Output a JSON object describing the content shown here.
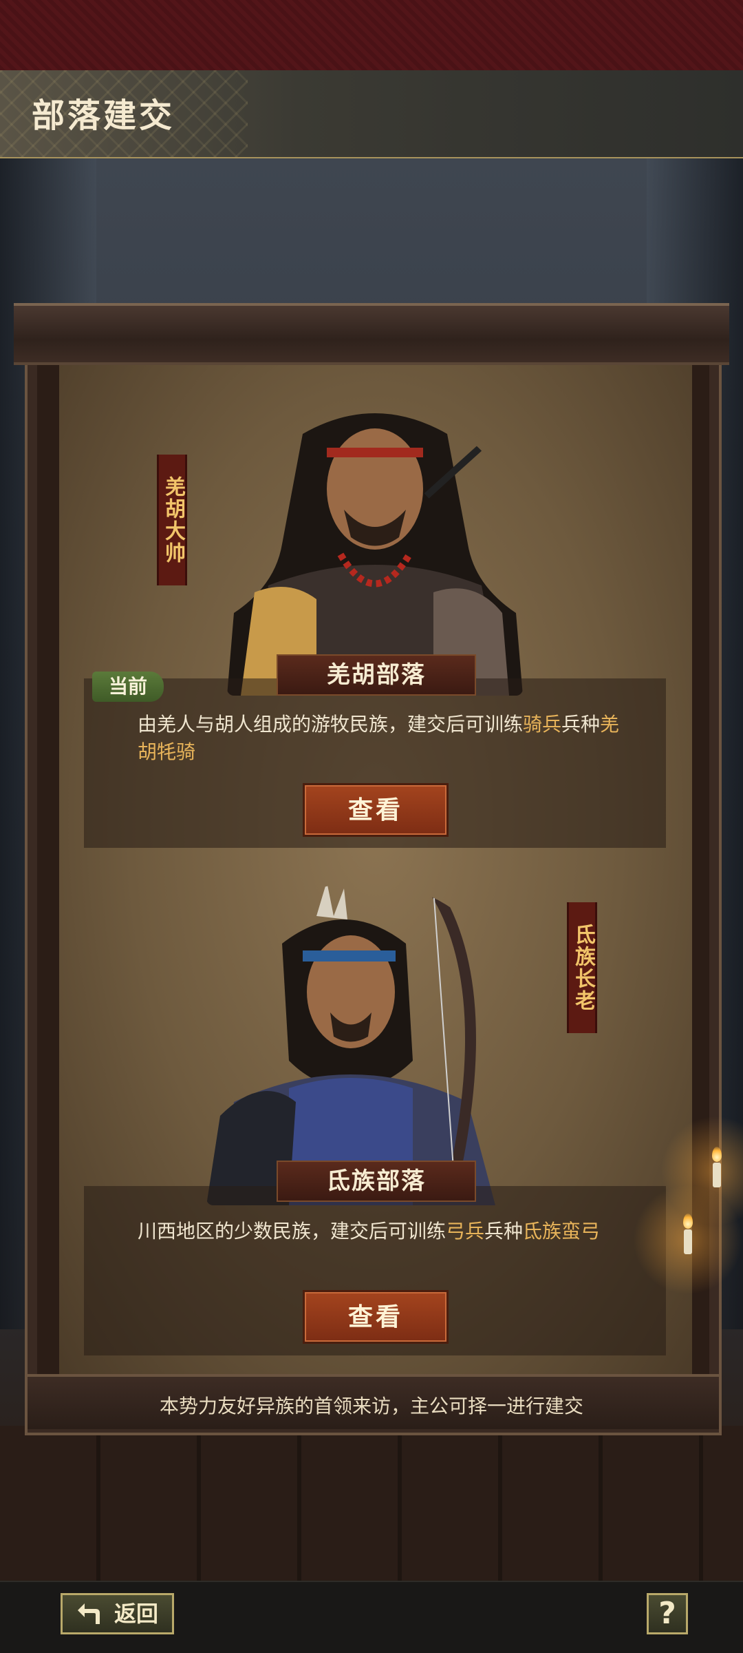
{
  "header": {
    "title": "部落建交"
  },
  "tribes": [
    {
      "title_tag": "羌胡大帅",
      "name": "羌胡部落",
      "badge": "当前",
      "description_parts": [
        {
          "text": "由羌人与胡人组成的游牧民族，建交后可训练",
          "highlight": false
        },
        {
          "text": "骑兵",
          "highlight": true
        },
        {
          "text": "兵种",
          "highlight": false
        },
        {
          "text": "羌胡牦骑",
          "highlight": true
        }
      ],
      "button": "查看"
    },
    {
      "title_tag": "氐族长老",
      "name": "氐族部落",
      "description_parts": [
        {
          "text": "川西地区的少数民族，建交后可训练",
          "highlight": false
        },
        {
          "text": "弓兵",
          "highlight": true
        },
        {
          "text": "兵种",
          "highlight": false
        },
        {
          "text": "氐族蛮弓",
          "highlight": true
        }
      ],
      "button": "查看"
    }
  ],
  "caption": "本势力友好异族的首领来访，主公可择一进行建交",
  "footer": {
    "back_label": "返回",
    "help_label": "?"
  },
  "colors": {
    "highlight": "#e8b45a",
    "button": "#a4441e",
    "badge": "#5b7a3a"
  }
}
